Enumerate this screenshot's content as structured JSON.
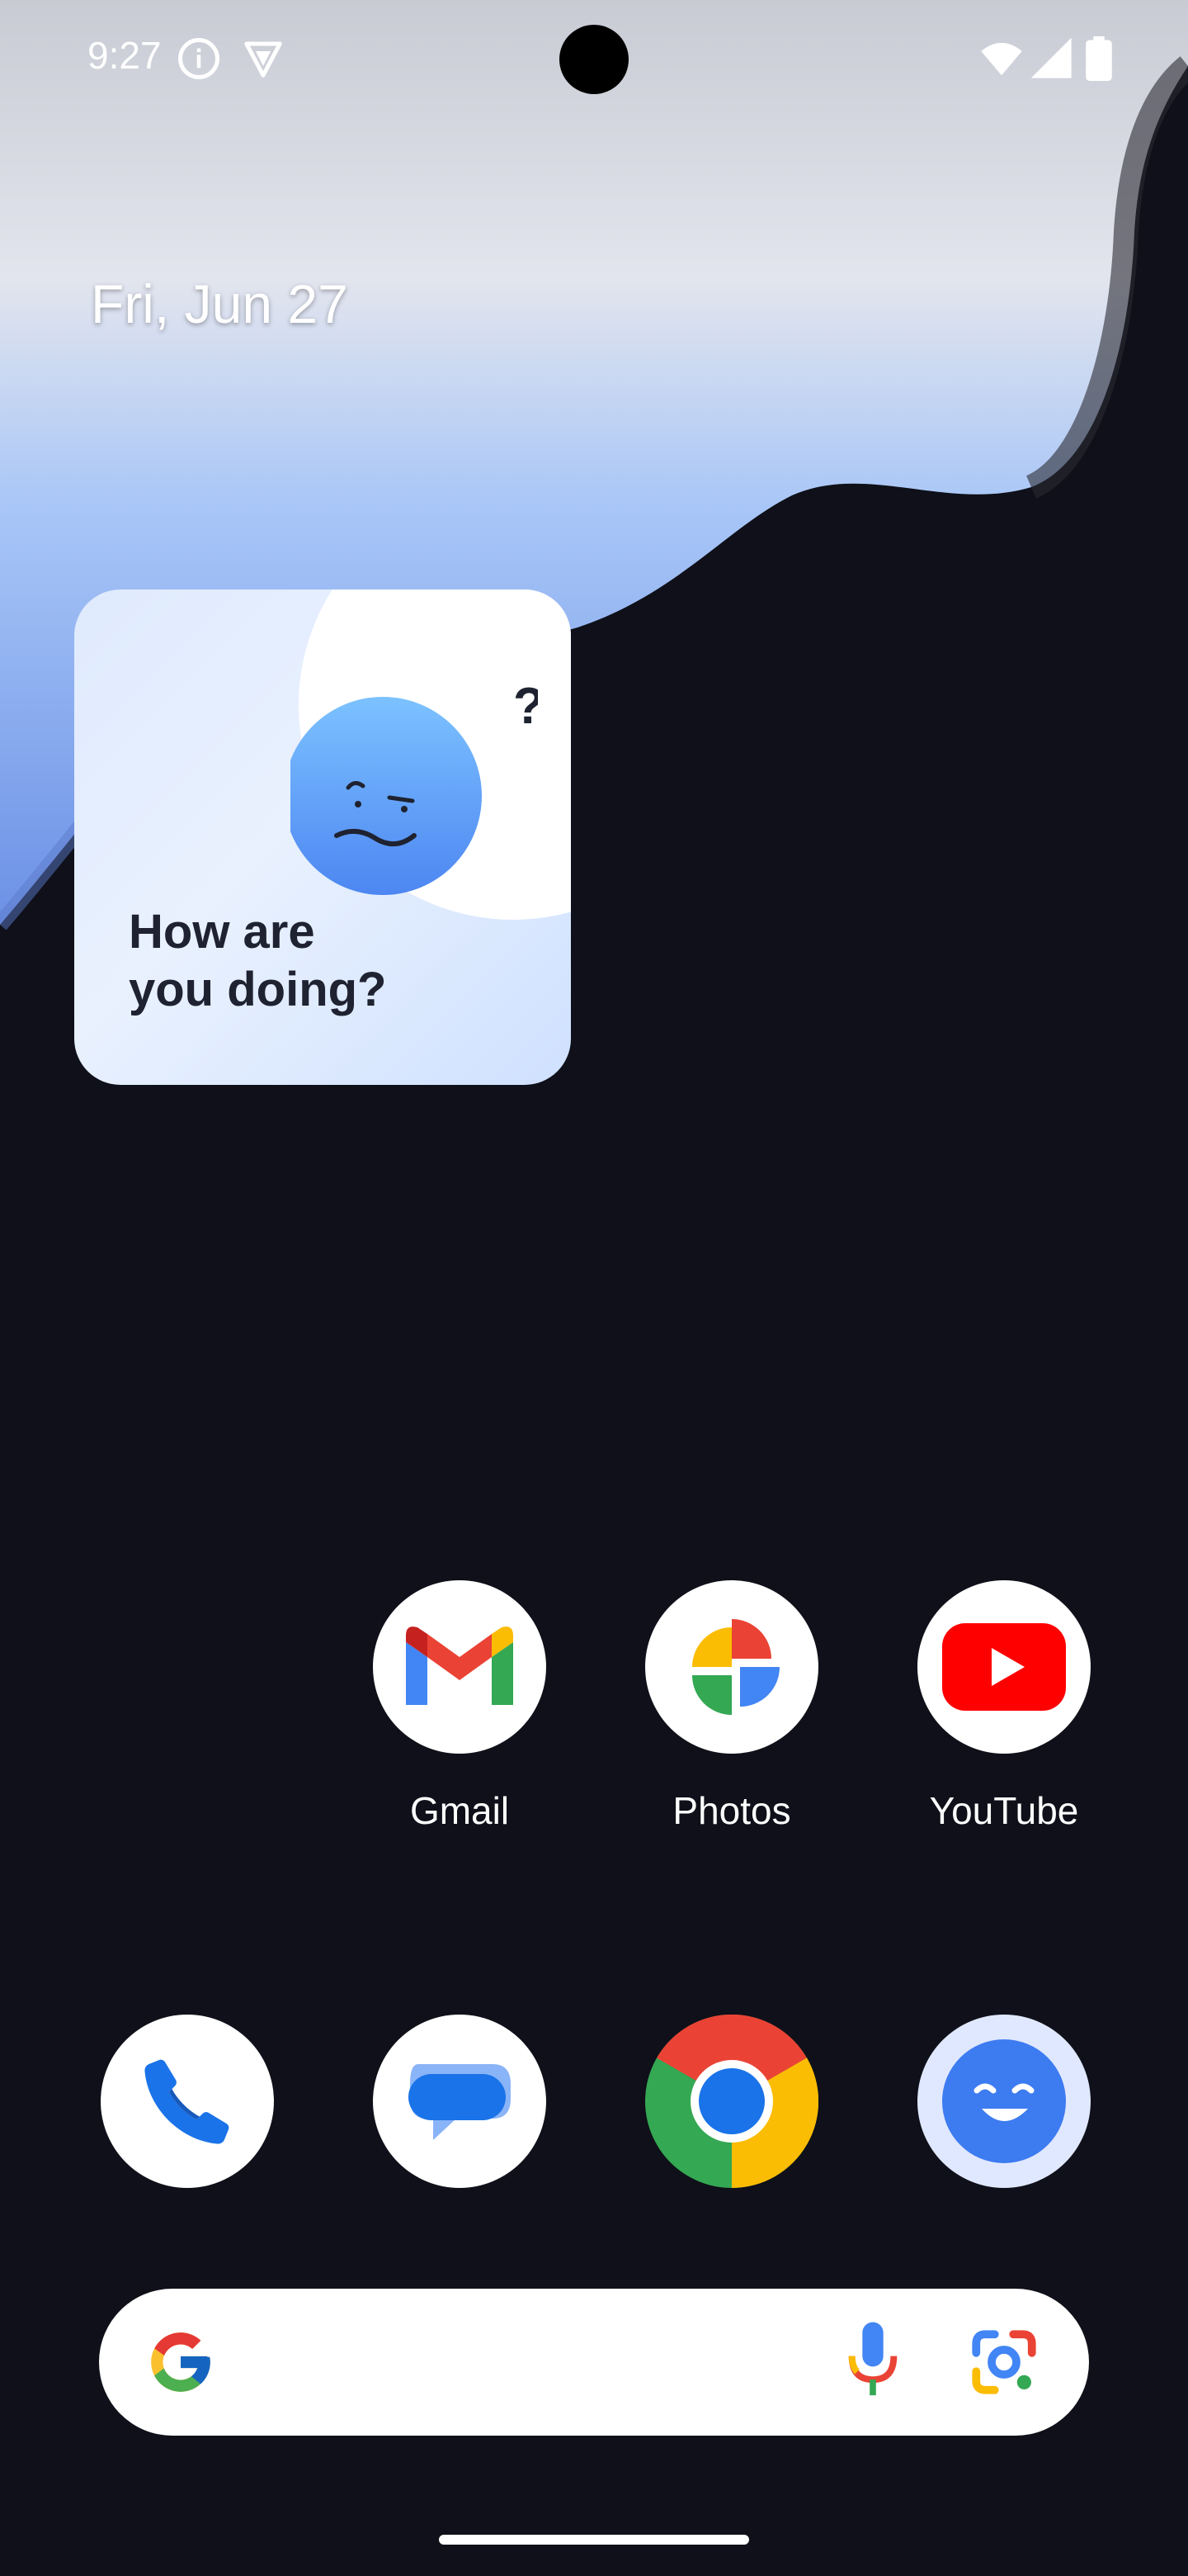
{
  "status_bar": {
    "time": "9:27",
    "left_icons": [
      "info-icon",
      "vpn-shield-icon"
    ],
    "right_icons": [
      "wifi-icon",
      "cellular-signal-icon",
      "battery-icon"
    ]
  },
  "home": {
    "date": "Fri, Jun 27",
    "widget": {
      "title": "How are\nyou doing?",
      "line1": "How are",
      "line2": "you doing?",
      "question_marks": "??",
      "icon": "confused-face-icon"
    },
    "apps_row": [
      {
        "label": "Gmail",
        "icon": "gmail-icon"
      },
      {
        "label": "Photos",
        "icon": "photos-icon"
      },
      {
        "label": "YouTube",
        "icon": "youtube-icon"
      }
    ],
    "dock": [
      {
        "icon": "phone-icon"
      },
      {
        "icon": "messages-icon"
      },
      {
        "icon": "chrome-icon"
      },
      {
        "icon": "smiley-app-icon"
      }
    ],
    "search_bar": {
      "icons": [
        "google-g-icon",
        "microphone-icon",
        "google-lens-icon"
      ]
    }
  },
  "colors": {
    "wallpaper_dark": "#0f1019",
    "widget_bg": "#dfeafd",
    "accent_blue": "#4285f4"
  }
}
